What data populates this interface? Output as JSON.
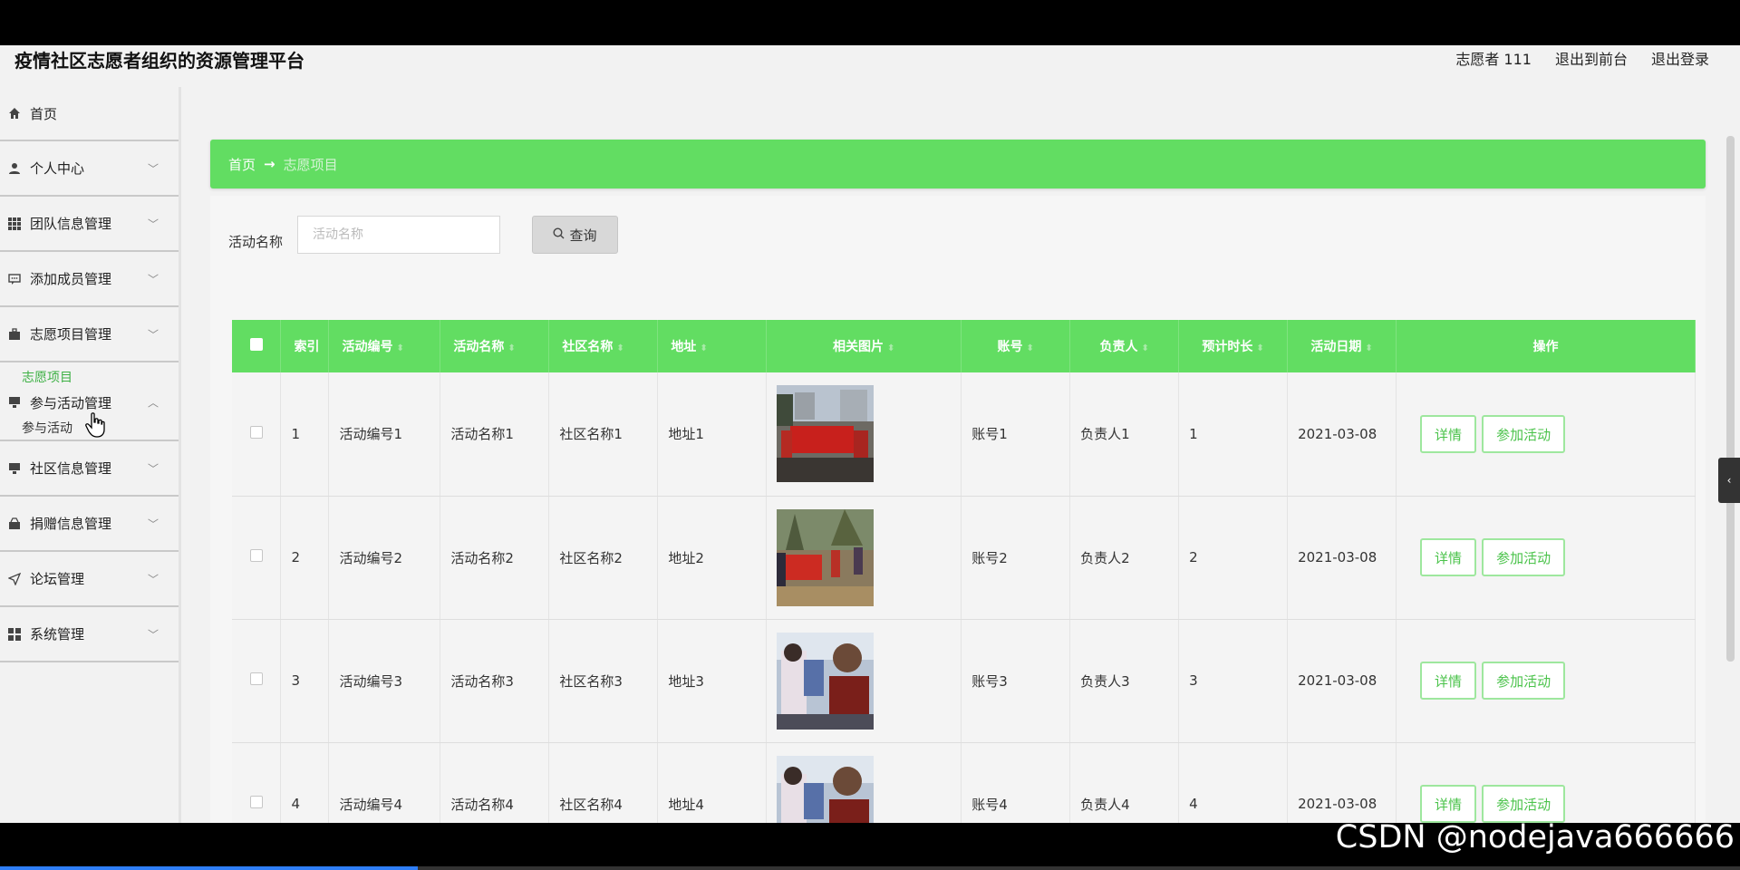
{
  "app_title": "疫情社区志愿者组织的资源管理平台",
  "header_links": [
    "志愿者 111",
    "退出到前台",
    "退出登录"
  ],
  "sidebar": {
    "items": [
      {
        "label": "首页",
        "icon": "home-icon"
      },
      {
        "label": "个人中心",
        "icon": "user-icon"
      },
      {
        "label": "团队信息管理",
        "icon": "grid-icon"
      },
      {
        "label": "添加成员管理",
        "icon": "chat-icon"
      },
      {
        "label": "志愿项目管理",
        "icon": "briefcase-icon",
        "sub": "志愿项目"
      },
      {
        "label": "参与活动管理",
        "icon": "monitor-icon",
        "sub": "参与活动"
      },
      {
        "label": "社区信息管理",
        "icon": "monitor-icon"
      },
      {
        "label": "捐赠信息管理",
        "icon": "box-icon"
      },
      {
        "label": "论坛管理",
        "icon": "send-icon"
      },
      {
        "label": "系统管理",
        "icon": "apps-icon"
      }
    ]
  },
  "breadcrumb": {
    "home": "首页",
    "separator": "→",
    "current": "志愿项目"
  },
  "search": {
    "label": "活动名称",
    "placeholder": "活动名称",
    "button": "查询"
  },
  "table": {
    "headers": [
      "索引",
      "活动编号",
      "活动名称",
      "社区名称",
      "地址",
      "相关图片",
      "账号",
      "负责人",
      "预计时长",
      "活动日期",
      "操作"
    ],
    "rows": [
      {
        "index": "1",
        "code": "活动编号1",
        "name": "活动名称1",
        "community": "社区名称1",
        "address": "地址1",
        "account": "账号1",
        "leader": "负责人1",
        "duration": "1",
        "date": "2021-03-08"
      },
      {
        "index": "2",
        "code": "活动编号2",
        "name": "活动名称2",
        "community": "社区名称2",
        "address": "地址2",
        "account": "账号2",
        "leader": "负责人2",
        "duration": "2",
        "date": "2021-03-08"
      },
      {
        "index": "3",
        "code": "活动编号3",
        "name": "活动名称3",
        "community": "社区名称3",
        "address": "地址3",
        "account": "账号3",
        "leader": "负责人3",
        "duration": "3",
        "date": "2021-03-08"
      },
      {
        "index": "4",
        "code": "活动编号4",
        "name": "活动名称4",
        "community": "社区名称4",
        "address": "地址4",
        "account": "账号4",
        "leader": "负责人4",
        "duration": "4",
        "date": "2021-03-08"
      }
    ],
    "actions": {
      "detail": "详情",
      "join": "参加活动"
    }
  },
  "watermark": "CSDN @nodejava666666",
  "colors": {
    "accent": "#62dd62",
    "action_text": "#4bc34b"
  },
  "video_progress": 0.24
}
